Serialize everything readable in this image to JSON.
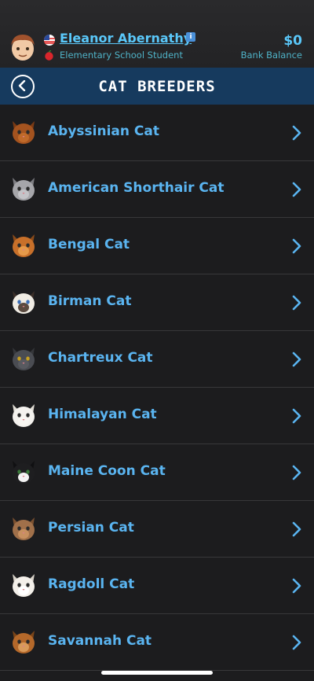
{
  "profile": {
    "name": "Eleanor Abernathy",
    "job": "Elementary School Student",
    "balance": "$0",
    "balance_label": "Bank Balance",
    "flag_icon": "us-flag-icon",
    "job_icon": "apple-icon",
    "info_icon_glyph": "i"
  },
  "header": {
    "title": "CAT BREEDERS",
    "back_icon": "back-chevron-icon"
  },
  "colors": {
    "accent": "#5ab4f0",
    "header_bg": "#163a5e",
    "page_bg": "#1c1c1e"
  },
  "breeders": [
    {
      "label": "Abyssinian Cat",
      "icon": "abyssinian-cat-icon"
    },
    {
      "label": "American Shorthair Cat",
      "icon": "american-shorthair-cat-icon"
    },
    {
      "label": "Bengal Cat",
      "icon": "bengal-cat-icon"
    },
    {
      "label": "Birman Cat",
      "icon": "birman-cat-icon"
    },
    {
      "label": "Chartreux Cat",
      "icon": "chartreux-cat-icon"
    },
    {
      "label": "Himalayan Cat",
      "icon": "himalayan-cat-icon"
    },
    {
      "label": "Maine Coon Cat",
      "icon": "maine-coon-cat-icon"
    },
    {
      "label": "Persian Cat",
      "icon": "persian-cat-icon"
    },
    {
      "label": "Ragdoll Cat",
      "icon": "ragdoll-cat-icon"
    },
    {
      "label": "Savannah Cat",
      "icon": "savannah-cat-icon"
    }
  ]
}
